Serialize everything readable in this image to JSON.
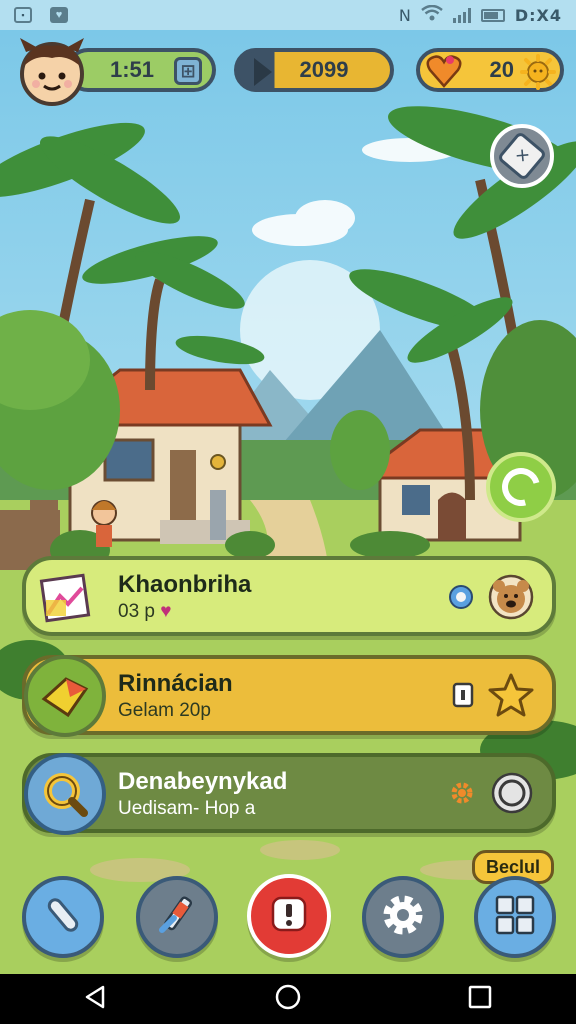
{
  "status_bar": {
    "time": "D:X4",
    "left_icons": [
      "notification-box-icon",
      "heart-notification-icon"
    ],
    "right_icons": [
      "nfc-icon",
      "wifi-icon",
      "signal-icon",
      "battery-icon"
    ]
  },
  "hud": {
    "timer": "1:51",
    "coins": "2099",
    "hearts": "20"
  },
  "quests": [
    {
      "title": "Khaonbriha",
      "subtitle": "03 p",
      "right_icons": [
        "target-icon",
        "bear-face-icon"
      ]
    },
    {
      "title": "Rinnácian",
      "subtitle": "Gelam  20p",
      "right_icons": [
        "ticket-icon",
        "star-icon"
      ]
    },
    {
      "title": "Denabeynykad",
      "subtitle": "Uedisam- Hop a",
      "right_icons": [
        "gear-small-icon",
        "ring-icon"
      ]
    }
  ],
  "badge": {
    "label": "Beclul"
  },
  "toolbar": {
    "buttons": [
      "pencil-icon",
      "tools-icon",
      "alert-icon",
      "settings-gear-icon",
      "grid-menu-icon"
    ]
  },
  "colors": {
    "card1": "#d7eb7c",
    "card2": "#ecbd3b",
    "card3": "#6e8a43",
    "alert_button": "#e23b35"
  }
}
